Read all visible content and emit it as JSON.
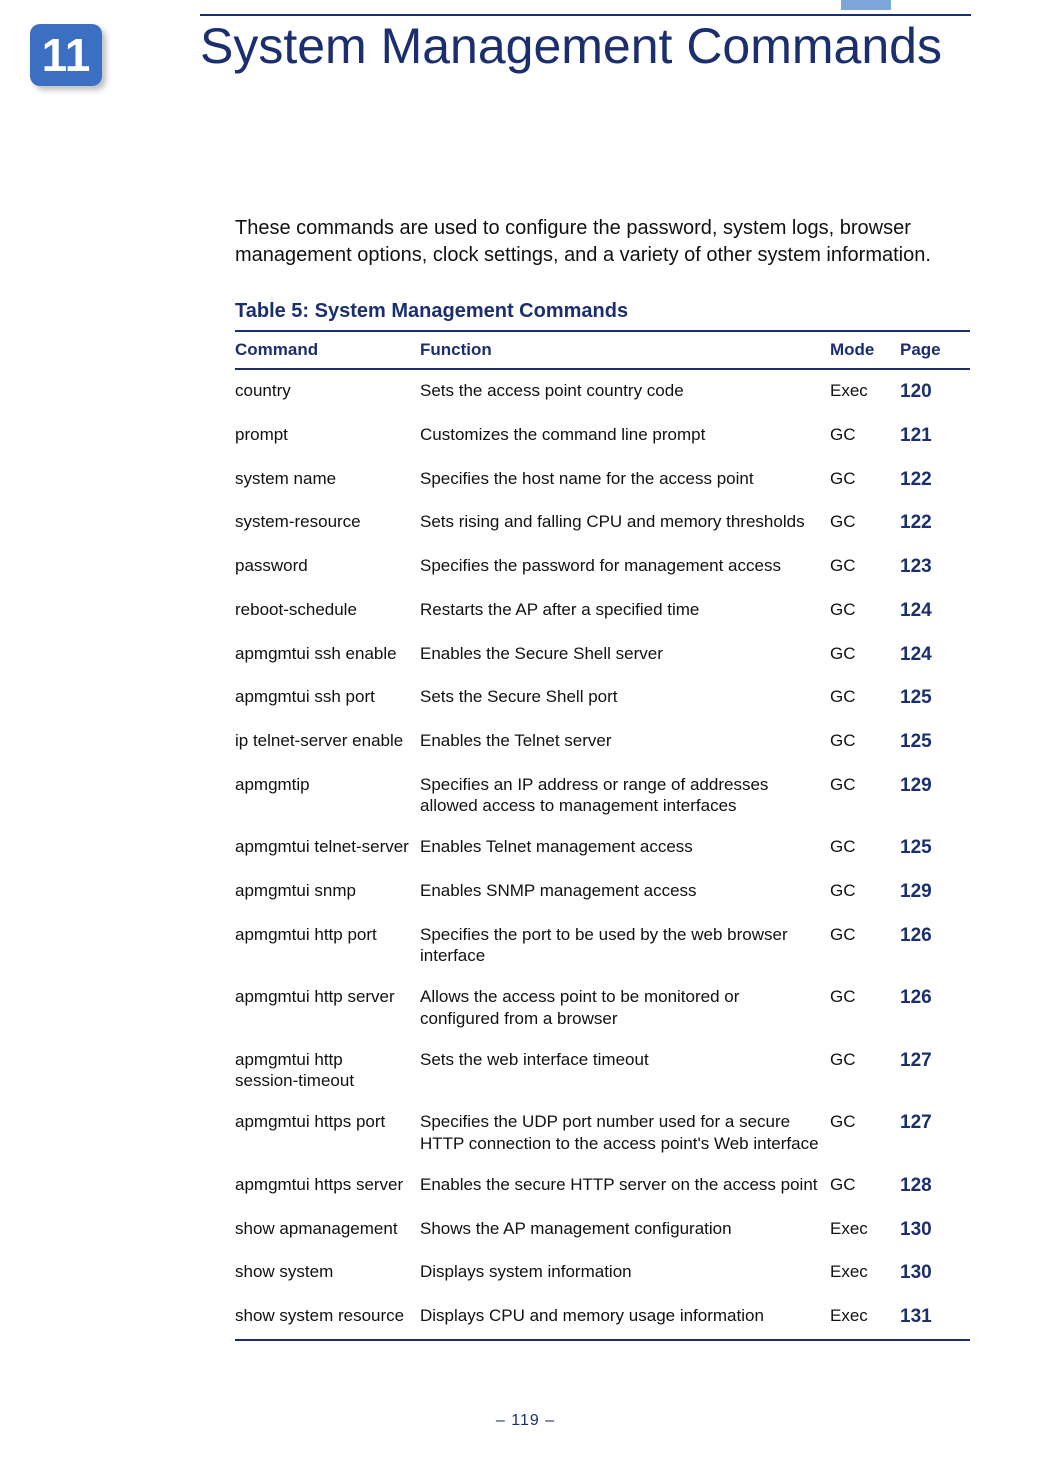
{
  "chapter": {
    "number": "11",
    "title": "System Management Commands"
  },
  "intro": "These commands are used to configure the password, system logs, browser management options, clock settings, and a variety of other system information.",
  "table": {
    "caption": "Table 5: System Management Commands",
    "headers": {
      "command": "Command",
      "function": "Function",
      "mode": "Mode",
      "page": "Page"
    },
    "rows": [
      {
        "command": "country",
        "function": "Sets the access point country code",
        "mode": "Exec",
        "page": "120"
      },
      {
        "command": "prompt",
        "function": "Customizes the command line prompt",
        "mode": "GC",
        "page": "121"
      },
      {
        "command": "system name",
        "function": "Specifies the host name for the access point",
        "mode": "GC",
        "page": "122"
      },
      {
        "command": "system-resource",
        "function": "Sets rising and falling CPU and memory thresholds",
        "mode": "GC",
        "page": "122"
      },
      {
        "command": "password",
        "function": "Specifies the password for management access",
        "mode": "GC",
        "page": "123"
      },
      {
        "command": "reboot-schedule",
        "function": "Restarts the AP after a specified time",
        "mode": "GC",
        "page": "124"
      },
      {
        "command": "apmgmtui ssh enable",
        "function": "Enables the Secure Shell server",
        "mode": "GC",
        "page": "124"
      },
      {
        "command": "apmgmtui ssh port",
        "function": "Sets the Secure Shell port",
        "mode": "GC",
        "page": "125"
      },
      {
        "command": "ip telnet-server enable",
        "function": "Enables the Telnet server",
        "mode": "GC",
        "page": "125"
      },
      {
        "command": "apmgmtip",
        "function": "Specifies an IP address or range of addresses allowed access to management interfaces",
        "mode": "GC",
        "page": "129"
      },
      {
        "command": "apmgmtui telnet-server",
        "function": "Enables Telnet management access",
        "mode": "GC",
        "page": "125"
      },
      {
        "command": "apmgmtui snmp",
        "function": "Enables SNMP management access",
        "mode": "GC",
        "page": "129"
      },
      {
        "command": "apmgmtui http port",
        "function": "Specifies the port to be used by the web browser interface",
        "mode": "GC",
        "page": "126"
      },
      {
        "command": "apmgmtui http server",
        "function": "Allows the access point to be monitored or configured from a browser",
        "mode": "GC",
        "page": "126"
      },
      {
        "command": "apmgmtui http session-timeout",
        "function": "Sets the web interface timeout",
        "mode": "GC",
        "page": "127"
      },
      {
        "command": "apmgmtui https port",
        "function": "Specifies the UDP port number used for a secure HTTP connection to the access point's Web interface",
        "mode": "GC",
        "page": "127"
      },
      {
        "command": "apmgmtui https server",
        "function": "Enables the secure HTTP server on the access point",
        "mode": "GC",
        "page": "128"
      },
      {
        "command": "show apmanagement",
        "function": "Shows the AP management configuration",
        "mode": "Exec",
        "page": "130"
      },
      {
        "command": "show system",
        "function": "Displays system information",
        "mode": "Exec",
        "page": "130"
      },
      {
        "command": "show system resource",
        "function": "Displays CPU and memory usage information",
        "mode": "Exec",
        "page": "131"
      }
    ]
  },
  "footer": {
    "page_number": "–  119  –"
  }
}
